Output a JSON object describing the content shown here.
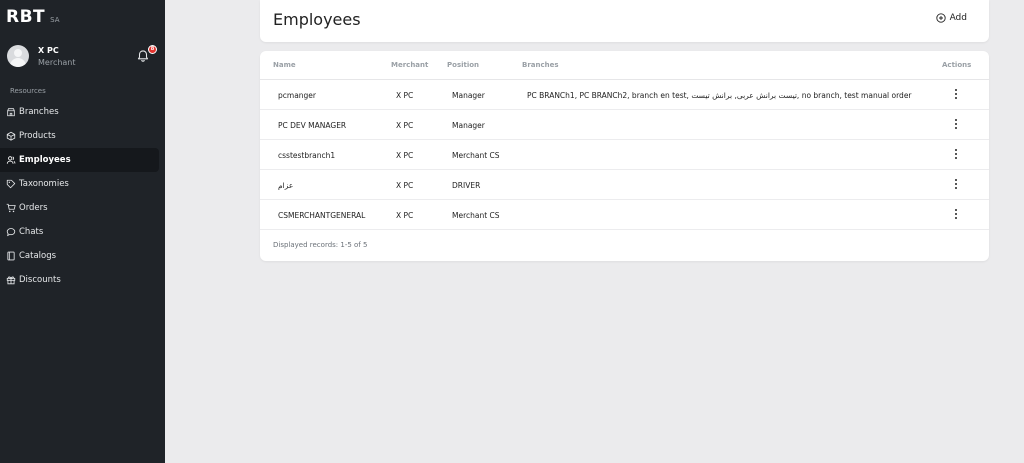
{
  "brand": {
    "name": "RBT",
    "sub": "SA"
  },
  "user": {
    "name": "X PC",
    "role": "Merchant",
    "notification_count": "8"
  },
  "sidebar": {
    "section_label": "Resources",
    "items": [
      {
        "label": "Branches",
        "icon": "storefront-icon"
      },
      {
        "label": "Products",
        "icon": "box-icon"
      },
      {
        "label": "Employees",
        "icon": "users-icon",
        "active": true
      },
      {
        "label": "Taxonomies",
        "icon": "tag-icon"
      },
      {
        "label": "Orders",
        "icon": "cart-icon"
      },
      {
        "label": "Chats",
        "icon": "chat-icon"
      },
      {
        "label": "Catalogs",
        "icon": "book-icon"
      },
      {
        "label": "Discounts",
        "icon": "gift-icon"
      }
    ]
  },
  "header": {
    "title": "Employees",
    "add_label": "Add"
  },
  "table": {
    "columns": {
      "name": "Name",
      "merchant": "Merchant",
      "position": "Position",
      "branches": "Branches",
      "actions": "Actions"
    },
    "rows": [
      {
        "name": "pcmanger",
        "merchant": "X PC",
        "position": "Manager",
        "branches": "PC BRANCh1, PC BRANCh2, branch en test, تيست برانش عربى, برانش تيست, no branch, test manual order"
      },
      {
        "name": "PC DEV MANAGER",
        "merchant": "X PC",
        "position": "Manager",
        "branches": ""
      },
      {
        "name": "csstestbranch1",
        "merchant": "X PC",
        "position": "Merchant CS",
        "branches": ""
      },
      {
        "name": "عزام",
        "merchant": "X PC",
        "position": "DRIVER",
        "branches": ""
      },
      {
        "name": "CSMERCHANTGENERAL",
        "merchant": "X PC",
        "position": "Merchant CS",
        "branches": ""
      }
    ],
    "footer": "Displayed records: 1-5 of 5"
  },
  "colors": {
    "sidebar_bg": "#1f2328",
    "active_bg": "#15181c",
    "page_bg": "#ebebed",
    "badge": "#e3342f"
  }
}
